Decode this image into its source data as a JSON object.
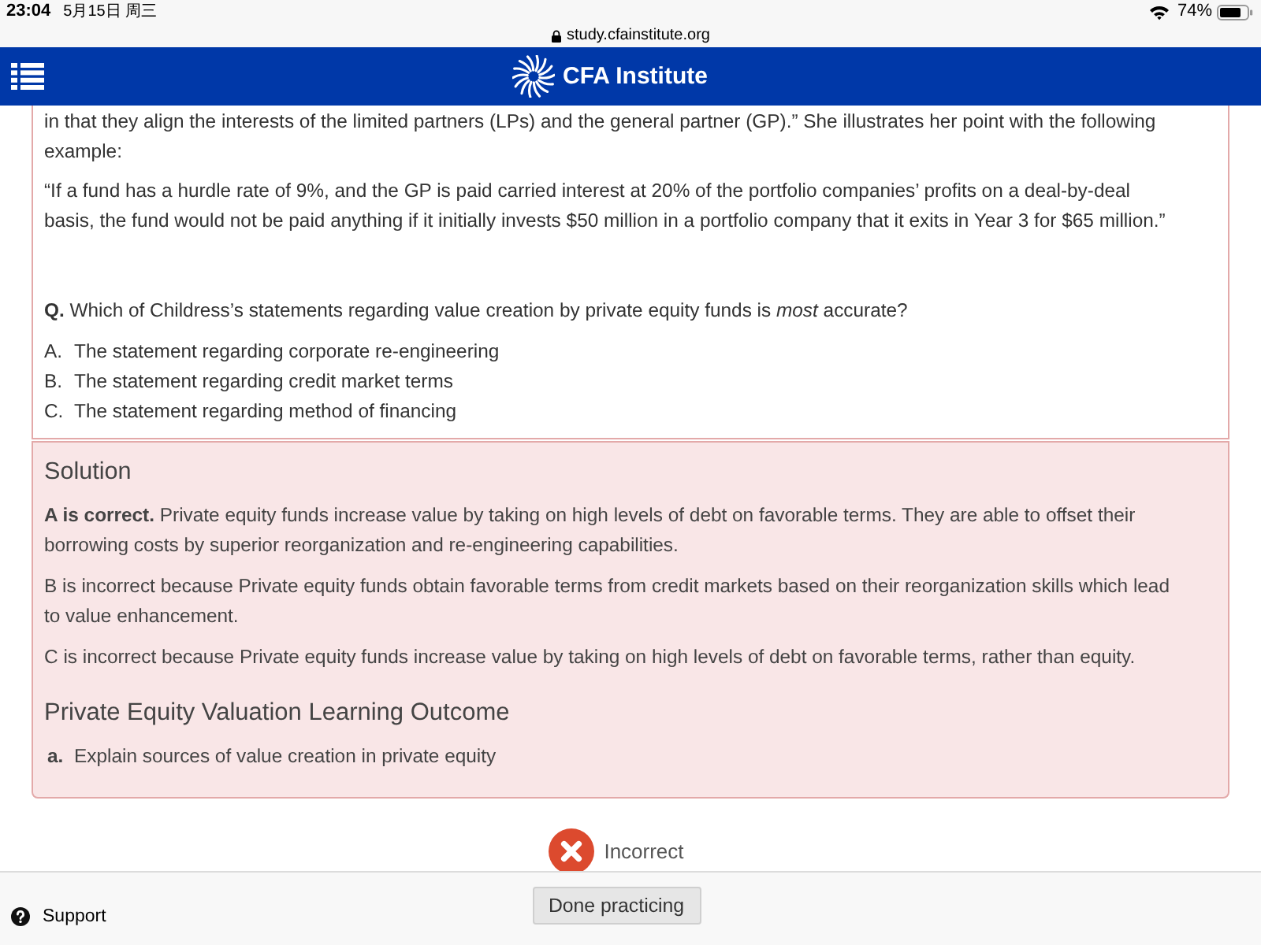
{
  "status_bar": {
    "time": "23:04",
    "date": "5月15日 周三",
    "battery": "74%"
  },
  "address_bar": {
    "url": "study.cfainstitute.org"
  },
  "header": {
    "logo_text": "CFA Institute"
  },
  "question": {
    "paragraphs": [
      "in that they align the interests of the limited partners (LPs) and the general partner (GP).” She illustrates her point with the following example:",
      "“If a fund has a hurdle rate of 9%, and the GP is paid carried interest at 20% of the portfolio companies’ profits on a deal-by-deal basis, the fund would not be paid anything if it initially invests $50 million in a portfolio company that it exits in Year 3 for $65 million.”"
    ],
    "prompt": "**Q.** Which of Childress’s statements regarding value creation by private equity funds is *most* accurate?",
    "options": [
      {
        "letter": "A.",
        "text": "The statement regarding corporate re-engineering"
      },
      {
        "letter": "B.",
        "text": "The statement regarding credit market terms"
      },
      {
        "letter": "C.",
        "text": "The statement regarding method of financing"
      }
    ]
  },
  "solution": {
    "title": "Solution",
    "paragraphs": [
      "**A is correct.** Private equity funds increase value by taking on high levels of debt on favorable terms. They are able to offset their borrowing costs by superior reorganization and re-engineering capabilities.",
      "B is incorrect because Private equity funds obtain favorable terms from credit markets based on their reorganization skills which lead to value enhancement.",
      "C is incorrect because Private equity funds increase value by taking on high levels of debt on favorable terms, rather than equity."
    ],
    "outcome_title": "Private Equity Valuation Learning Outcome",
    "outcomes": [
      {
        "letter": "a.",
        "text": "Explain sources of value creation in private equity"
      }
    ]
  },
  "result": {
    "correct": false,
    "label": "Incorrect"
  },
  "footer": {
    "support": "Support",
    "button": "Done practicing"
  }
}
